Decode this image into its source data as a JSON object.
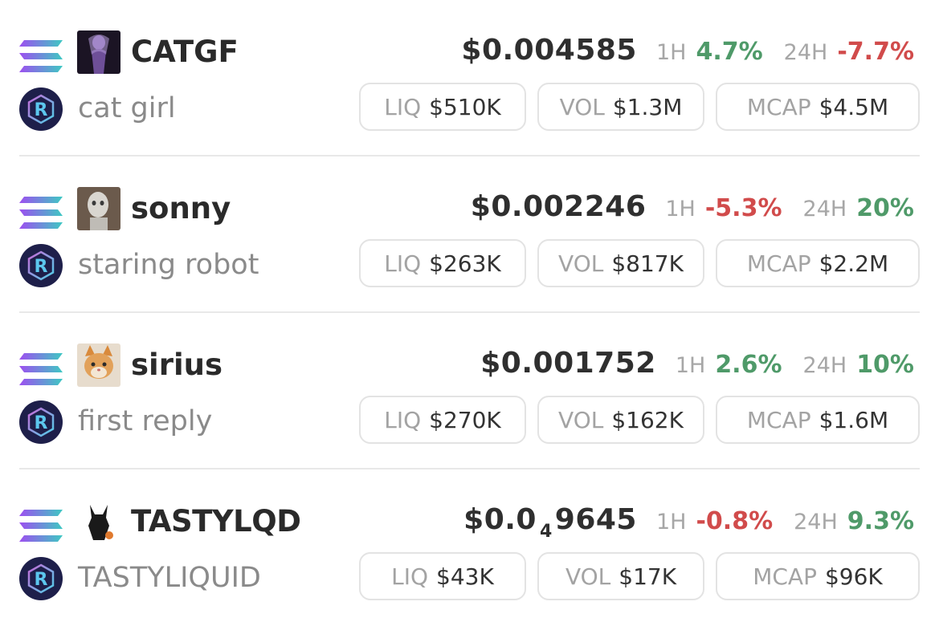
{
  "colors": {
    "up": "#4f9a69",
    "down": "#d14b4b",
    "muted": "#a7a7a7",
    "text": "#2b2b2b"
  },
  "labels": {
    "h1": "1H",
    "h24": "24H",
    "liq": "LIQ",
    "vol": "VOL",
    "mcap": "MCAP"
  },
  "tokens": [
    {
      "symbol": "CATGF",
      "name": "cat girl",
      "price_main": "$0.004585",
      "price_sub": "",
      "price_tail": "",
      "change_1h": "4.7%",
      "change_1h_dir": "up",
      "change_24h": "-7.7%",
      "change_24h_dir": "down",
      "liq": "$510K",
      "vol": "$1.3M",
      "mcap": "$4.5M",
      "avatar_icon": "anime-girl-avatar-icon"
    },
    {
      "symbol": "sonny",
      "name": "staring robot",
      "price_main": "$0.002246",
      "price_sub": "",
      "price_tail": "",
      "change_1h": "-5.3%",
      "change_1h_dir": "down",
      "change_24h": "20%",
      "change_24h_dir": "up",
      "liq": "$263K",
      "vol": "$817K",
      "mcap": "$2.2M",
      "avatar_icon": "robot-avatar-icon"
    },
    {
      "symbol": "sirius",
      "name": "first reply",
      "price_main": "$0.001752",
      "price_sub": "",
      "price_tail": "",
      "change_1h": "2.6%",
      "change_1h_dir": "up",
      "change_24h": "10%",
      "change_24h_dir": "up",
      "liq": "$270K",
      "vol": "$162K",
      "mcap": "$1.6M",
      "avatar_icon": "kitten-avatar-icon"
    },
    {
      "symbol": "TASTYLQD",
      "name": "TASTYLIQUID",
      "price_main": "$0.0",
      "price_sub": "4",
      "price_tail": "9645",
      "change_1h": "-0.8%",
      "change_1h_dir": "down",
      "change_24h": "9.3%",
      "change_24h_dir": "up",
      "liq": "$43K",
      "vol": "$17K",
      "mcap": "$96K",
      "avatar_icon": "fox-silhouette-avatar-icon"
    }
  ]
}
